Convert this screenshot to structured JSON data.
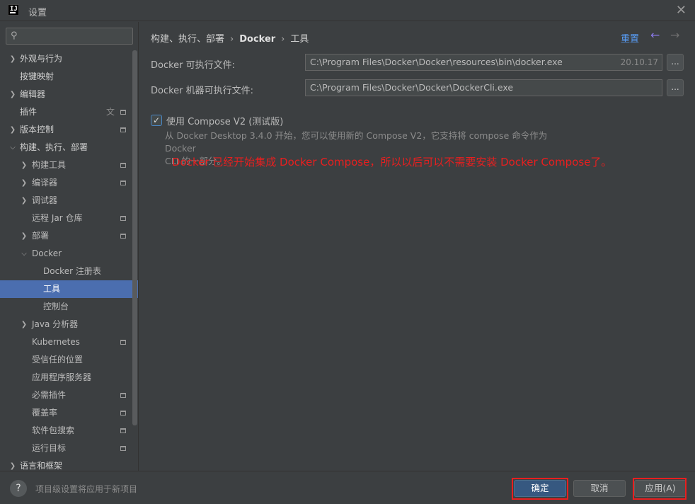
{
  "window": {
    "title": "设置",
    "logo_text": "IJ"
  },
  "sidebar": {
    "search_placeholder": "",
    "items": [
      {
        "label": "外观与行为"
      },
      {
        "label": "按键映射"
      },
      {
        "label": "编辑器"
      },
      {
        "label": "插件"
      },
      {
        "label": "版本控制"
      },
      {
        "label": "构建、执行、部署"
      },
      {
        "label": "构建工具"
      },
      {
        "label": "编译器"
      },
      {
        "label": "调试器"
      },
      {
        "label": "远程 Jar 仓库"
      },
      {
        "label": "部署"
      },
      {
        "label": "Docker"
      },
      {
        "label": "Docker 注册表"
      },
      {
        "label": "工具"
      },
      {
        "label": "控制台"
      },
      {
        "label": "Java 分析器"
      },
      {
        "label": "Kubernetes"
      },
      {
        "label": "受信任的位置"
      },
      {
        "label": "应用程序服务器"
      },
      {
        "label": "必需插件"
      },
      {
        "label": "覆盖率"
      },
      {
        "label": "软件包搜索"
      },
      {
        "label": "运行目标"
      },
      {
        "label": "语言和框架"
      }
    ]
  },
  "breadcrumb": {
    "part1": "构建、执行、部署",
    "part2": "Docker",
    "part3": "工具",
    "reset": "重置"
  },
  "fields": {
    "docker_exe_label": "Docker 可执行文件:",
    "docker_exe_value": "C:\\Program Files\\Docker\\Docker\\resources\\bin\\docker.exe",
    "docker_version": "20.10.17",
    "docker_machine_label": "Docker 机器可执行文件:",
    "docker_machine_value": "C:\\Program Files\\Docker\\Docker\\DockerCli.exe",
    "browse": "..."
  },
  "compose": {
    "checkbox_label": "使用 Compose V2 (测试版)",
    "checked": true,
    "description_line1": "从 Docker Desktop 3.4.0 开始，您可以使用新的 Compose V2，它支持将 compose 命令作为 Docker",
    "description_line2": "CLI 的一部分。",
    "annotation": "Docker 已经开始集成 Docker Compose，所以以后可以不需要安装 Docker Compose了。"
  },
  "footer": {
    "note": "项目级设置将应用于新项目",
    "ok": "确定",
    "cancel": "取消",
    "apply": "应用(A)"
  },
  "colors": {
    "accent": "#4b6eaf",
    "annotation_red": "#e81f1f",
    "link": "#589df6"
  }
}
